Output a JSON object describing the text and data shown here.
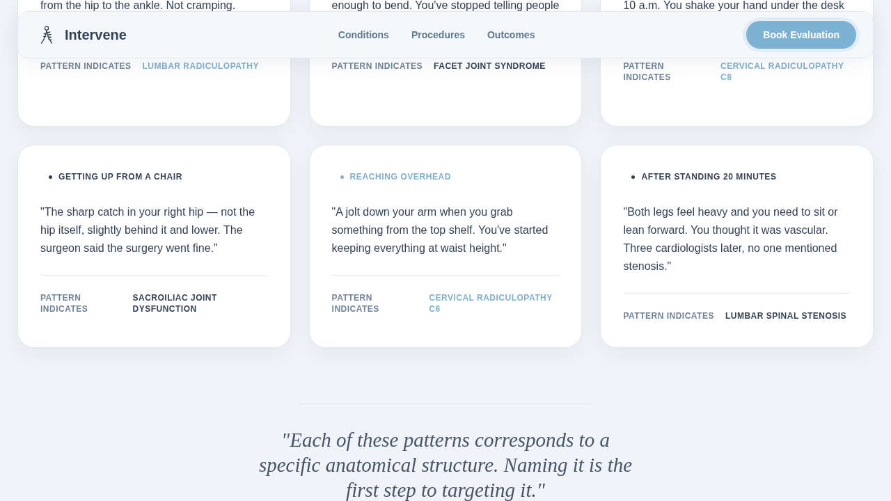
{
  "nav": {
    "brand": "Intervene",
    "links": [
      {
        "label": "Conditions"
      },
      {
        "label": "Procedures"
      },
      {
        "label": "Outcomes"
      }
    ],
    "cta": "Book Evaluation"
  },
  "cards": [
    {
      "kind": "cut",
      "quote": "from the hip to the ankle. Not cramping.",
      "label": "PATTERN INDICATES",
      "diagnosis": {
        "text": "LUMBAR RADICULOPATHY",
        "color": "#7fb0cf"
      }
    },
    {
      "kind": "cut",
      "quote": "enough to bend. You've stopped telling people",
      "label": "PATTERN INDICATES",
      "diagnosis": {
        "text": "FACET JOINT SYNDROME",
        "color": "#334155"
      }
    },
    {
      "kind": "cut",
      "quote": "10 a.m. You shake your hand under the desk",
      "label": "PATTERN INDICATES",
      "diagnosis": {
        "text": "CERVICAL RADICULOPATHY C8",
        "color": "#7fb0cf"
      }
    },
    {
      "kind": "full",
      "trigger": {
        "text": "GETTING UP FROM A CHAIR",
        "color": "#334155"
      },
      "quote": "\"The sharp catch in your right hip — not the hip itself, slightly behind it and lower. The surgeon said the surgery went fine.\"",
      "label": "PATTERN INDICATES",
      "diagnosis": {
        "text": "SACROILIAC JOINT DYSFUNCTION",
        "color": "#334155"
      }
    },
    {
      "kind": "full",
      "trigger": {
        "text": "REACHING OVERHEAD",
        "color": "#7fb0cf"
      },
      "quote": "\"A jolt down your arm when you grab something from the top shelf. You've started keeping everything at waist height.\"",
      "label": "PATTERN INDICATES",
      "diagnosis": {
        "text": "CERVICAL RADICULOPATHY C6",
        "color": "#7fb0cf"
      }
    },
    {
      "kind": "full",
      "trigger": {
        "text": "AFTER STANDING 20 MINUTES",
        "color": "#334155"
      },
      "quote": "\"Both legs feel heavy and you need to sit or lean forward. You thought it was vascular. Three cardiologists later, no one mentioned stenosis.\"",
      "label": "PATTERN INDICATES",
      "diagnosis": {
        "text": "LUMBAR SPINAL STENOSIS",
        "color": "#334155"
      }
    }
  ],
  "closing_quote": "\"Each of these patterns corresponds to a specific anatomical structure. Naming it is the first step to targeting it.\""
}
